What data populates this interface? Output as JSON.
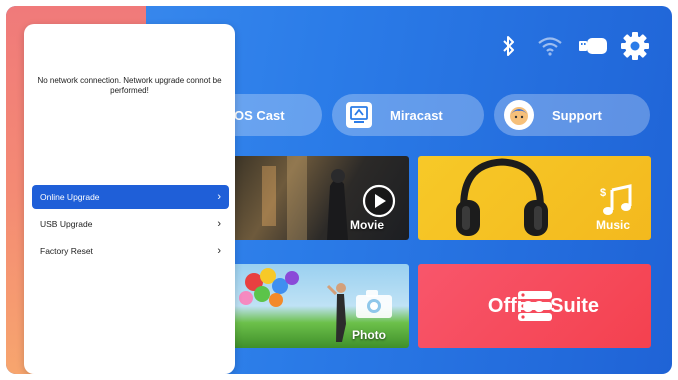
{
  "status_bar": {
    "icons": [
      "bluetooth-icon",
      "wifi-icon",
      "usb-drive-icon",
      "settings-gear-icon"
    ]
  },
  "cast_buttons": [
    {
      "label": "iOS Cast",
      "visible_text": "OS Cast",
      "icon": "ios-cast-icon"
    },
    {
      "label": "Miracast",
      "visible_text": "Miracast",
      "icon": "miracast-icon"
    },
    {
      "label": "Support",
      "visible_text": "Support",
      "icon": "support-icon"
    }
  ],
  "tiles": {
    "movie": {
      "label": "Movie",
      "icon": "play-icon"
    },
    "music": {
      "label": "Music",
      "icon": "music-note-icon"
    },
    "photo": {
      "label": "Photo",
      "icon": "camera-icon"
    },
    "office": {
      "label": "Office Suite",
      "icon": "office-list-icon"
    }
  },
  "dialog": {
    "message": "No network connection. Network upgrade connot be performed!",
    "menu": [
      {
        "label": "Online Upgrade",
        "selected": true
      },
      {
        "label": "USB Upgrade",
        "selected": false
      },
      {
        "label": "Factory Reset",
        "selected": false
      }
    ]
  },
  "colors": {
    "background_blue": "#2b7ce8",
    "selected_item": "#1f5fd8",
    "music_tile": "#f7c928",
    "office_tile": "#f4414f",
    "left_strip": "#f48a74"
  }
}
